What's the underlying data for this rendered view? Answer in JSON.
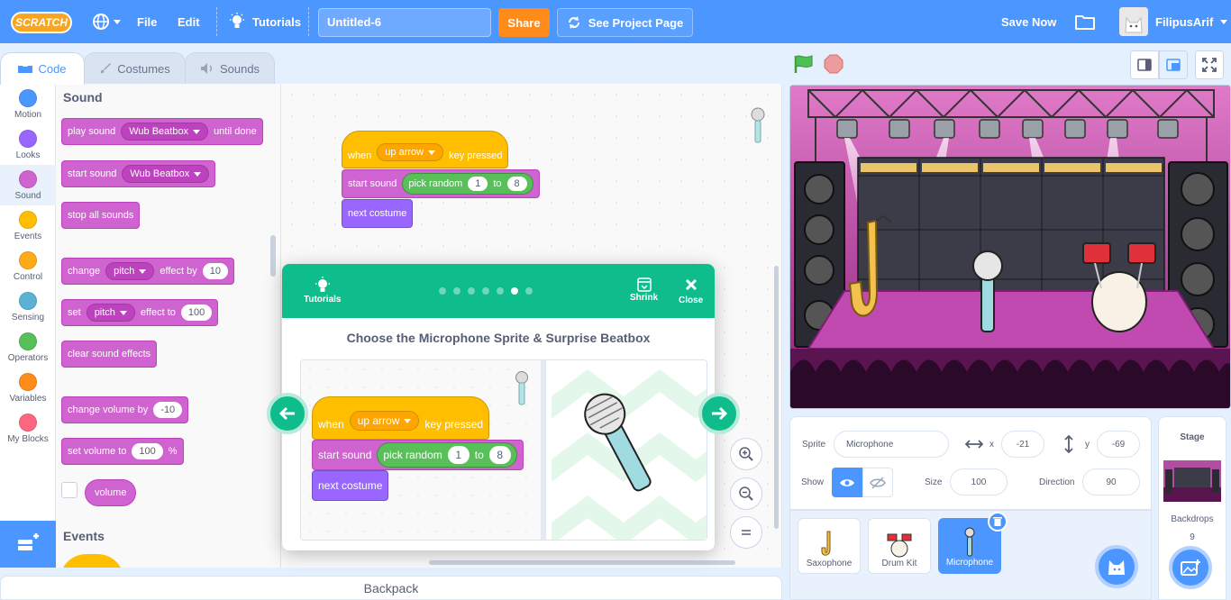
{
  "menubar": {
    "logo": "SCRATCH",
    "file": "File",
    "edit": "Edit",
    "tutorials": "Tutorials",
    "project_title": "Untitled-6",
    "share": "Share",
    "see_project": "See Project Page",
    "save_now": "Save Now",
    "username": "FilipusArif"
  },
  "tabs": {
    "code": "Code",
    "costumes": "Costumes",
    "sounds": "Sounds"
  },
  "categories": [
    {
      "label": "Motion",
      "color": "#4c97ff"
    },
    {
      "label": "Looks",
      "color": "#9966ff"
    },
    {
      "label": "Sound",
      "color": "#cf63cf"
    },
    {
      "label": "Events",
      "color": "#ffbf00"
    },
    {
      "label": "Control",
      "color": "#ffab19"
    },
    {
      "label": "Sensing",
      "color": "#5cb1d6"
    },
    {
      "label": "Operators",
      "color": "#59c059"
    },
    {
      "label": "Variables",
      "color": "#ff8c1a"
    },
    {
      "label": "My Blocks",
      "color": "#ff6680"
    }
  ],
  "palette": {
    "sound_header": "Sound",
    "play_sound": "play sound",
    "play_sound_arg": "Wub Beatbox",
    "until_done": "until done",
    "start_sound": "start sound",
    "start_sound_arg": "Wub Beatbox",
    "stop_all": "stop all sounds",
    "change": "change",
    "pitch1": "pitch",
    "effect_by": "effect by",
    "effect_by_val": "10",
    "set": "set",
    "pitch2": "pitch",
    "effect_to": "effect to",
    "effect_to_val": "100",
    "clear_effects": "clear sound effects",
    "change_volume": "change volume by",
    "change_volume_val": "-10",
    "set_volume": "set volume to",
    "set_volume_val": "100",
    "percent": "%",
    "volume": "volume",
    "events_header": "Events"
  },
  "script": {
    "when": "when",
    "key": "up arrow",
    "key_pressed": "key pressed",
    "start_sound": "start sound",
    "pick_random": "pick random",
    "from": "1",
    "to": "to",
    "to_val": "8",
    "next_costume": "next costume"
  },
  "backpack": "Backpack",
  "tutorial": {
    "tutorials": "Tutorials",
    "shrink": "Shrink",
    "close": "Close",
    "title": "Choose the Microphone Sprite & Surprise Beatbox",
    "step_count": 7,
    "current_step": 6
  },
  "sprite_info": {
    "sprite_label": "Sprite",
    "sprite_name": "Microphone",
    "x_label": "x",
    "x": "-21",
    "y_label": "y",
    "y": "-69",
    "show_label": "Show",
    "size_label": "Size",
    "size": "100",
    "direction_label": "Direction",
    "direction": "90"
  },
  "sprites": [
    {
      "name": "Saxophone",
      "selected": false
    },
    {
      "name": "Drum Kit",
      "selected": false
    },
    {
      "name": "Microphone",
      "selected": true
    }
  ],
  "stage_pane": {
    "label": "Stage",
    "backdrops_label": "Backdrops",
    "backdrops_count": "9"
  },
  "colors": {
    "accent": "#4c97ff",
    "tutorial": "#0fbd8c",
    "sound": "#cf63cf",
    "events": "#ffbf00",
    "looks": "#9966ff",
    "operators": "#59c059"
  }
}
